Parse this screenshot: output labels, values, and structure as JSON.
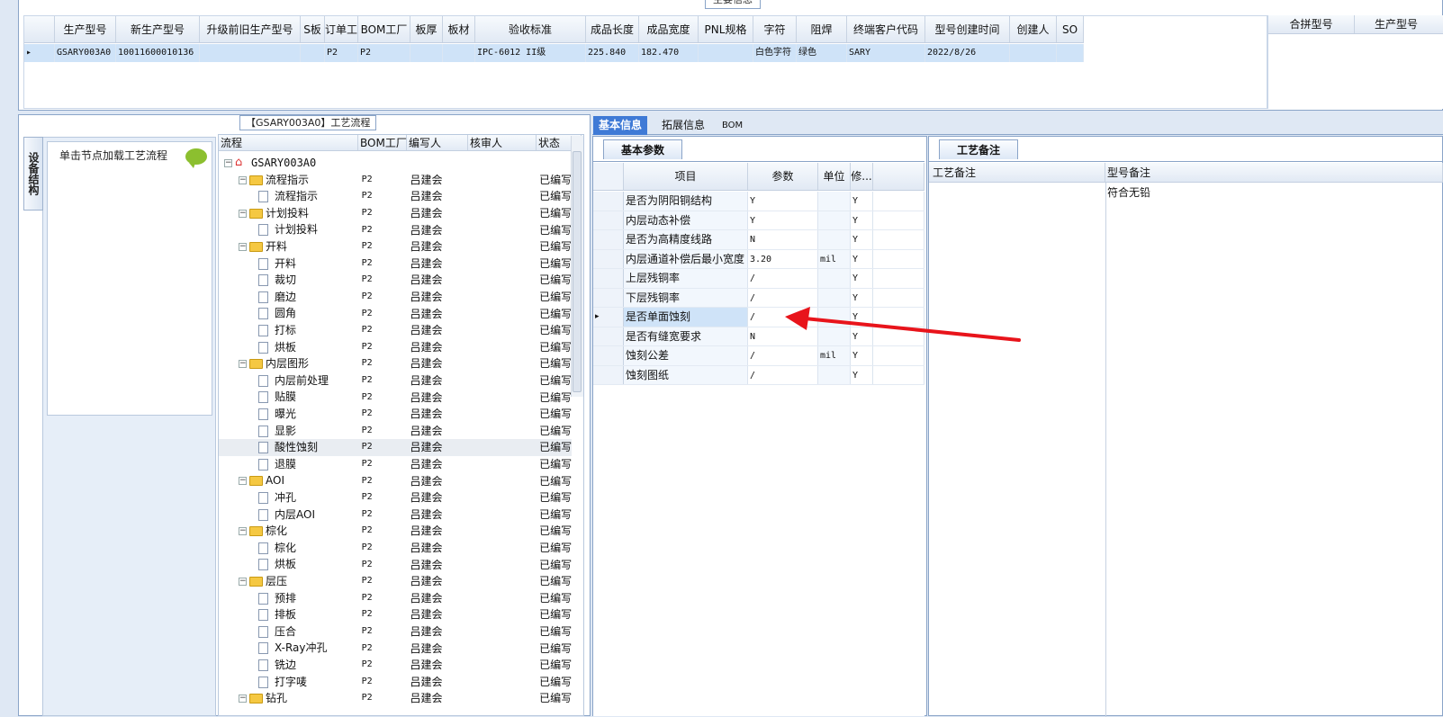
{
  "top": {
    "title": "主要信息",
    "columns": [
      "生产型号",
      "新生产型号",
      "升级前旧生产型号",
      "S板",
      "订单工厂",
      "BOM工厂",
      "板厚",
      "板材",
      "验收标准",
      "成品长度",
      "成品宽度",
      "PNL规格",
      "字符",
      "阻焊",
      "终端客户代码",
      "型号创建时间",
      "创建人",
      "SO"
    ],
    "row": [
      "GSARY003A0",
      "10011600010136",
      "",
      "",
      "P2",
      "P2",
      "",
      "",
      "IPC-6012 II级",
      "225.840",
      "182.470",
      "",
      "白色字符",
      "绿色",
      "SARY",
      "2022/8/26",
      "",
      ""
    ],
    "merge_cols": [
      "合拼型号",
      "生产型号"
    ]
  },
  "process": {
    "title": "【GSARY003A0】工艺流程",
    "side_tab": "设备结构",
    "card_label": "单击节点加载工艺流程",
    "columns": [
      "流程",
      "BOM工厂",
      "编写人",
      "核审人",
      "状态"
    ],
    "rows": [
      {
        "lv": 0,
        "k": "home",
        "name": "GSARY003A0",
        "f": "",
        "w": "",
        "r": "",
        "s": ""
      },
      {
        "lv": 1,
        "k": "folder",
        "name": "流程指示",
        "f": "P2",
        "w": "吕建会",
        "r": "",
        "s": "已编写"
      },
      {
        "lv": 2,
        "k": "doc",
        "name": "流程指示",
        "f": "P2",
        "w": "吕建会",
        "r": "",
        "s": "已编写"
      },
      {
        "lv": 1,
        "k": "folder",
        "name": "计划投料",
        "f": "P2",
        "w": "吕建会",
        "r": "",
        "s": "已编写"
      },
      {
        "lv": 2,
        "k": "doc",
        "name": "计划投料",
        "f": "P2",
        "w": "吕建会",
        "r": "",
        "s": "已编写"
      },
      {
        "lv": 1,
        "k": "folder",
        "name": "开料",
        "f": "P2",
        "w": "吕建会",
        "r": "",
        "s": "已编写"
      },
      {
        "lv": 2,
        "k": "doc",
        "name": "开料",
        "f": "P2",
        "w": "吕建会",
        "r": "",
        "s": "已编写"
      },
      {
        "lv": 2,
        "k": "doc",
        "name": "裁切",
        "f": "P2",
        "w": "吕建会",
        "r": "",
        "s": "已编写"
      },
      {
        "lv": 2,
        "k": "doc",
        "name": "磨边",
        "f": "P2",
        "w": "吕建会",
        "r": "",
        "s": "已编写"
      },
      {
        "lv": 2,
        "k": "doc",
        "name": "圆角",
        "f": "P2",
        "w": "吕建会",
        "r": "",
        "s": "已编写"
      },
      {
        "lv": 2,
        "k": "doc",
        "name": "打标",
        "f": "P2",
        "w": "吕建会",
        "r": "",
        "s": "已编写"
      },
      {
        "lv": 2,
        "k": "doc",
        "name": "烘板",
        "f": "P2",
        "w": "吕建会",
        "r": "",
        "s": "已编写"
      },
      {
        "lv": 1,
        "k": "folder",
        "name": "内层图形",
        "f": "P2",
        "w": "吕建会",
        "r": "",
        "s": "已编写"
      },
      {
        "lv": 2,
        "k": "doc",
        "name": "内层前处理",
        "f": "P2",
        "w": "吕建会",
        "r": "",
        "s": "已编写"
      },
      {
        "lv": 2,
        "k": "doc",
        "name": "贴膜",
        "f": "P2",
        "w": "吕建会",
        "r": "",
        "s": "已编写"
      },
      {
        "lv": 2,
        "k": "doc",
        "name": "曝光",
        "f": "P2",
        "w": "吕建会",
        "r": "",
        "s": "已编写"
      },
      {
        "lv": 2,
        "k": "doc",
        "name": "显影",
        "f": "P2",
        "w": "吕建会",
        "r": "",
        "s": "已编写"
      },
      {
        "lv": 2,
        "k": "doc",
        "name": "酸性蚀刻",
        "f": "P2",
        "w": "吕建会",
        "r": "",
        "s": "已编写",
        "sel": true
      },
      {
        "lv": 2,
        "k": "doc",
        "name": "退膜",
        "f": "P2",
        "w": "吕建会",
        "r": "",
        "s": "已编写"
      },
      {
        "lv": 1,
        "k": "folder",
        "name": "AOI",
        "f": "P2",
        "w": "吕建会",
        "r": "",
        "s": "已编写"
      },
      {
        "lv": 2,
        "k": "doc",
        "name": "冲孔",
        "f": "P2",
        "w": "吕建会",
        "r": "",
        "s": "已编写"
      },
      {
        "lv": 2,
        "k": "doc",
        "name": "内层AOI",
        "f": "P2",
        "w": "吕建会",
        "r": "",
        "s": "已编写"
      },
      {
        "lv": 1,
        "k": "folder",
        "name": "棕化",
        "f": "P2",
        "w": "吕建会",
        "r": "",
        "s": "已编写"
      },
      {
        "lv": 2,
        "k": "doc",
        "name": "棕化",
        "f": "P2",
        "w": "吕建会",
        "r": "",
        "s": "已编写"
      },
      {
        "lv": 2,
        "k": "doc",
        "name": "烘板",
        "f": "P2",
        "w": "吕建会",
        "r": "",
        "s": "已编写"
      },
      {
        "lv": 1,
        "k": "folder",
        "name": "层压",
        "f": "P2",
        "w": "吕建会",
        "r": "",
        "s": "已编写"
      },
      {
        "lv": 2,
        "k": "doc",
        "name": "预排",
        "f": "P2",
        "w": "吕建会",
        "r": "",
        "s": "已编写"
      },
      {
        "lv": 2,
        "k": "doc",
        "name": "排板",
        "f": "P2",
        "w": "吕建会",
        "r": "",
        "s": "已编写"
      },
      {
        "lv": 2,
        "k": "doc",
        "name": "压合",
        "f": "P2",
        "w": "吕建会",
        "r": "",
        "s": "已编写"
      },
      {
        "lv": 2,
        "k": "doc",
        "name": "X-Ray冲孔",
        "f": "P2",
        "w": "吕建会",
        "r": "",
        "s": "已编写"
      },
      {
        "lv": 2,
        "k": "doc",
        "name": "铣边",
        "f": "P2",
        "w": "吕建会",
        "r": "",
        "s": "已编写"
      },
      {
        "lv": 2,
        "k": "doc",
        "name": "打字唛",
        "f": "P2",
        "w": "吕建会",
        "r": "",
        "s": "已编写"
      },
      {
        "lv": 1,
        "k": "folder",
        "name": "钻孔",
        "f": "P2",
        "w": "吕建会",
        "r": "",
        "s": "已编写"
      }
    ]
  },
  "tabs": {
    "basic": "基本信息",
    "ext": "拓展信息",
    "bom": "BOM"
  },
  "params": {
    "tab": "基本参数",
    "columns": [
      "项目",
      "参数",
      "单位",
      "修..."
    ],
    "rows": [
      {
        "item": "是否为阴阳铜结构",
        "val": "Y",
        "unit": "",
        "mod": "Y"
      },
      {
        "item": "内层动态补偿",
        "val": "Y",
        "unit": "",
        "mod": "Y"
      },
      {
        "item": "是否为高精度线路",
        "val": "N",
        "unit": "",
        "mod": "Y"
      },
      {
        "item": "内层通道补偿后最小宽度",
        "val": "3.20",
        "unit": "mil",
        "mod": "Y"
      },
      {
        "item": "上层残铜率",
        "val": "/",
        "unit": "",
        "mod": "Y"
      },
      {
        "item": "下层残铜率",
        "val": "/",
        "unit": "",
        "mod": "Y"
      },
      {
        "item": "是否单面蚀刻",
        "val": "/",
        "unit": "",
        "mod": "Y",
        "cur": true
      },
      {
        "item": "是否有缝宽要求",
        "val": "N",
        "unit": "",
        "mod": "Y"
      },
      {
        "item": "蚀刻公差",
        "val": "/",
        "unit": "mil",
        "mod": "Y"
      },
      {
        "item": "蚀刻图纸",
        "val": "/",
        "unit": "",
        "mod": "Y"
      }
    ]
  },
  "remarks": {
    "tab": "工艺备注",
    "columns": [
      "工艺备注",
      "型号备注"
    ],
    "model_remark": "符合无铅"
  },
  "colors": {
    "accent": "#3f7ad6",
    "selected_row": "#cfe3f8",
    "arrow": "#e8141b"
  }
}
